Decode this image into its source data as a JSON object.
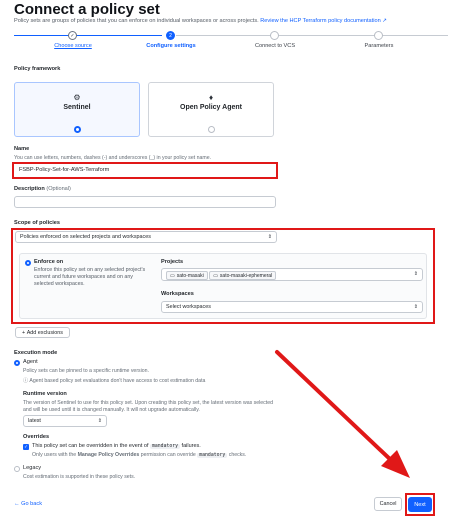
{
  "page": {
    "title": "Connect a policy set",
    "description": "Policy sets are groups of policies that you can enforce on individual workspaces or across projects.",
    "description_link": "Review the HCP Terraform policy documentation"
  },
  "stepper": {
    "steps": [
      {
        "label": "Choose source",
        "state": "done"
      },
      {
        "label": "Configure settings",
        "state": "active",
        "number": "2"
      },
      {
        "label": "Connect to VCS",
        "state": "todo"
      },
      {
        "label": "Parameters",
        "state": "todo"
      }
    ]
  },
  "policy_framework": {
    "label": "Policy framework",
    "options": [
      {
        "name": "Sentinel",
        "selected": true
      },
      {
        "name": "Open Policy Agent",
        "selected": false
      }
    ]
  },
  "name_field": {
    "label": "Name",
    "hint": "You can use letters, numbers, dashes (-) and underscores (_) in your policy set name.",
    "value": "FSBP-Policy-Set-for-AWS-Terraform"
  },
  "description_field": {
    "label": "Description",
    "optional": "(Optional)",
    "value": ""
  },
  "scope": {
    "label": "Scope of policies",
    "selected": "Policies enforced on selected projects and workspaces",
    "enforce_title": "Enforce on",
    "enforce_desc": "Enforce this policy set on any selected project's current and future workspaces and on any selected workspaces.",
    "projects_label": "Projects",
    "projects": [
      "sato-masaki",
      "sato-masaki-ephemeral"
    ],
    "workspaces_label": "Workspaces",
    "workspaces_placeholder": "Select workspaces",
    "add_exclusions": "Add exclusions"
  },
  "execution": {
    "label": "Execution mode",
    "agent_label": "Agent",
    "agent_desc": "Policy sets can be pinned to a specific runtime version.",
    "agent_info": "Agent based policy set evaluations don't have access to cost estimation data",
    "runtime_label": "Runtime version",
    "runtime_desc_1": "The version of Sentinel to use for this policy set. Upon creating this policy set, the latest version was selected",
    "runtime_desc_2": "and will be used until it is changed manually. It will not upgrade automatically.",
    "runtime_value": "latest",
    "overrides_label": "Overrides",
    "overrides_check_pre": "This policy set can be overridden in the event of",
    "overrides_code": "mandatory",
    "overrides_check_post": "failures.",
    "overrides_note_pre": "Only users with the",
    "overrides_note_bold": "Manage Policy Overrides",
    "overrides_note_mid": "permission can override",
    "overrides_note_code": "mandatory",
    "overrides_note_post": "checks.",
    "legacy_label": "Legacy",
    "legacy_desc": "Cost estimation is supported in these policy sets."
  },
  "footer": {
    "back": "Go back",
    "cancel": "Cancel",
    "next": "Next"
  },
  "colors": {
    "primary": "#1060ff",
    "annotation": "#e01818"
  }
}
